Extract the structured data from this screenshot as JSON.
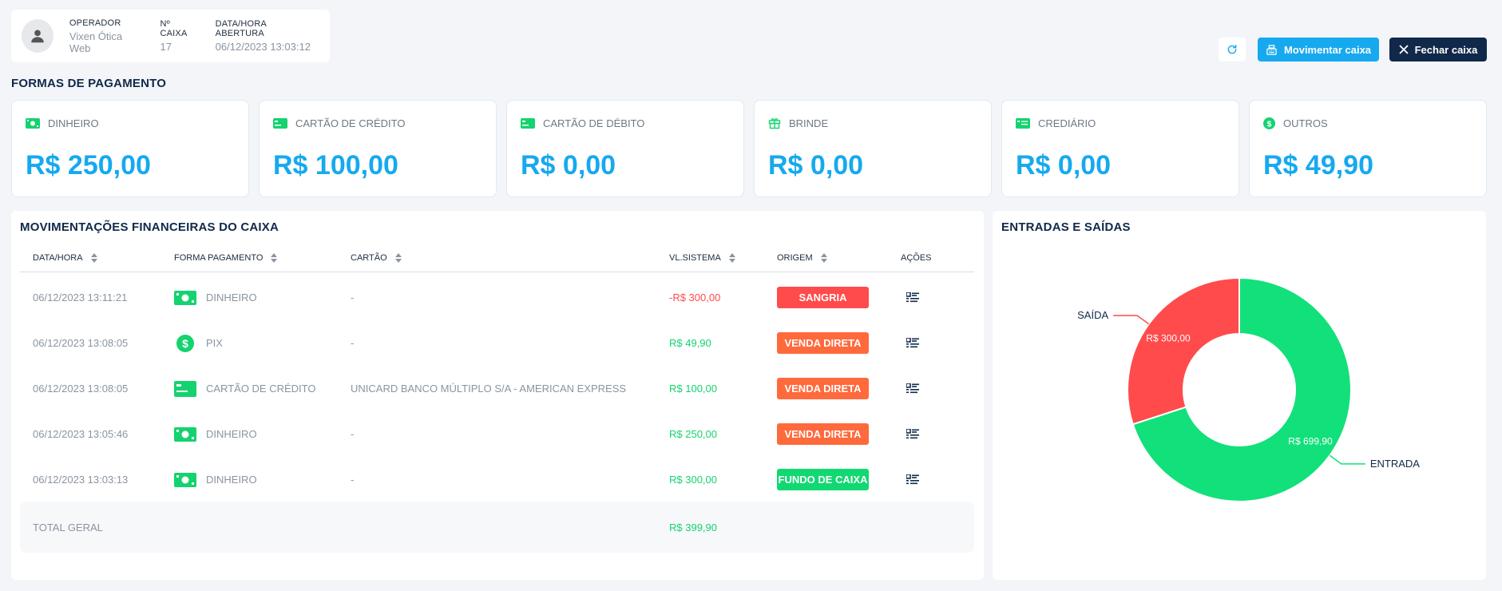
{
  "operator": {
    "operador_label": "OPERADOR",
    "operador_value": "Vixen Ótica Web",
    "caixa_label": "Nº CAIXA",
    "caixa_value": "17",
    "abertura_label": "DATA/HORA ABERTURA",
    "abertura_value": "06/12/2023 13:03:12"
  },
  "toolbar": {
    "move_label": "Movimentar caixa",
    "close_label": "Fechar caixa"
  },
  "payments": {
    "title": "FORMAS DE PAGAMENTO",
    "cards": [
      {
        "label": "DINHEIRO",
        "value": "R$ 250,00",
        "icon": "cash-icon"
      },
      {
        "label": "CARTÃO DE CRÉDITO",
        "value": "R$ 100,00",
        "icon": "credit-card-icon"
      },
      {
        "label": "CARTÃO DE DÉBITO",
        "value": "R$ 0,00",
        "icon": "debit-card-icon"
      },
      {
        "label": "BRINDE",
        "value": "R$ 0,00",
        "icon": "gift-icon"
      },
      {
        "label": "CREDIÁRIO",
        "value": "R$ 0,00",
        "icon": "credit-store-icon"
      },
      {
        "label": "OUTROS",
        "value": "R$ 49,90",
        "icon": "dollar-coin-icon"
      }
    ]
  },
  "movements": {
    "title": "MOVIMENTAÇÕES FINANCEIRAS DO CAIXA",
    "columns": {
      "datahora": "DATA/HORA",
      "forma": "FORMA PAGAMENTO",
      "cartao": "CARTÃO",
      "valor": "VL.SISTEMA",
      "origem": "ORIGEM",
      "acoes": "AÇÕES"
    },
    "rows": [
      {
        "datahora": "06/12/2023 13:11:21",
        "forma": "DINHEIRO",
        "cartao": "-",
        "valor": "-R$ 300,00",
        "origem": "SANGRIA"
      },
      {
        "datahora": "06/12/2023 13:08:05",
        "forma": "PIX",
        "cartao": "-",
        "valor": "R$ 49,90",
        "origem": "VENDA DIRETA"
      },
      {
        "datahora": "06/12/2023 13:08:05",
        "forma": "CARTÃO DE CRÉDITO",
        "cartao": "UNICARD BANCO MÚLTIPLO S/A - AMERICAN EXPRESS",
        "valor": "R$ 100,00",
        "origem": "VENDA DIRETA"
      },
      {
        "datahora": "06/12/2023 13:05:46",
        "forma": "DINHEIRO",
        "cartao": "-",
        "valor": "R$ 250,00",
        "origem": "VENDA DIRETA"
      },
      {
        "datahora": "06/12/2023 13:03:13",
        "forma": "DINHEIRO",
        "cartao": "-",
        "valor": "R$ 300,00",
        "origem": "FUNDO DE CAIXA"
      }
    ],
    "total_label": "TOTAL GERAL",
    "total_value": "R$ 399,90"
  },
  "chart": {
    "title": "ENTRADAS E SAÍDAS"
  },
  "chart_data": {
    "type": "pie",
    "title": "ENTRADAS E SAÍDAS",
    "categories": [
      "SAÍDA",
      "ENTRADA"
    ],
    "values": [
      300.0,
      699.9
    ],
    "data_labels": [
      "R$ 300,00",
      "R$ 699,90"
    ],
    "colors": [
      "#ff4b4b",
      "#12e07a"
    ],
    "donut": true
  },
  "colors": {
    "accent": "#16a9ef",
    "navy": "#10294a",
    "positive": "#14d36f",
    "negative": "#ff4b4b",
    "orange": "#ff6a3d"
  }
}
